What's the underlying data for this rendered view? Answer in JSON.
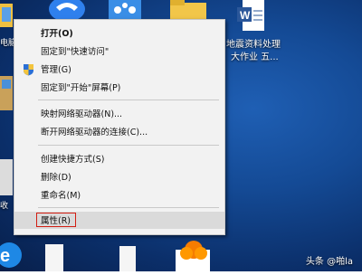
{
  "desktop": {
    "labels": {
      "left_top": "电脑",
      "left_bottom": "收",
      "word_file": "地震资料处理",
      "word_folder": "大作业 五..."
    },
    "icons": [
      "recycle-bin-icon",
      "folder-icon",
      "network-icon",
      "word-icon",
      "edge-icon",
      "file-icon",
      "cloud-app-icon"
    ]
  },
  "context_menu": {
    "items": [
      {
        "label": "打开(O)",
        "bold": true
      },
      {
        "label": "固定到\"快速访问\""
      },
      {
        "label": "管理(G)",
        "icon": "shield-icon"
      },
      {
        "label": "固定到\"开始\"屏幕(P)"
      },
      {
        "label": "映射网络驱动器(N)..."
      },
      {
        "label": "断开网络驱动器的连接(C)..."
      },
      {
        "label": "创建快捷方式(S)"
      },
      {
        "label": "删除(D)"
      },
      {
        "label": "重命名(M)"
      },
      {
        "label": "属性(R)",
        "highlighted": true
      }
    ]
  },
  "watermark": "头条 @啪la",
  "colors": {
    "highlight_box": "#d21d12",
    "menu_bg": "#f2f2f2"
  }
}
